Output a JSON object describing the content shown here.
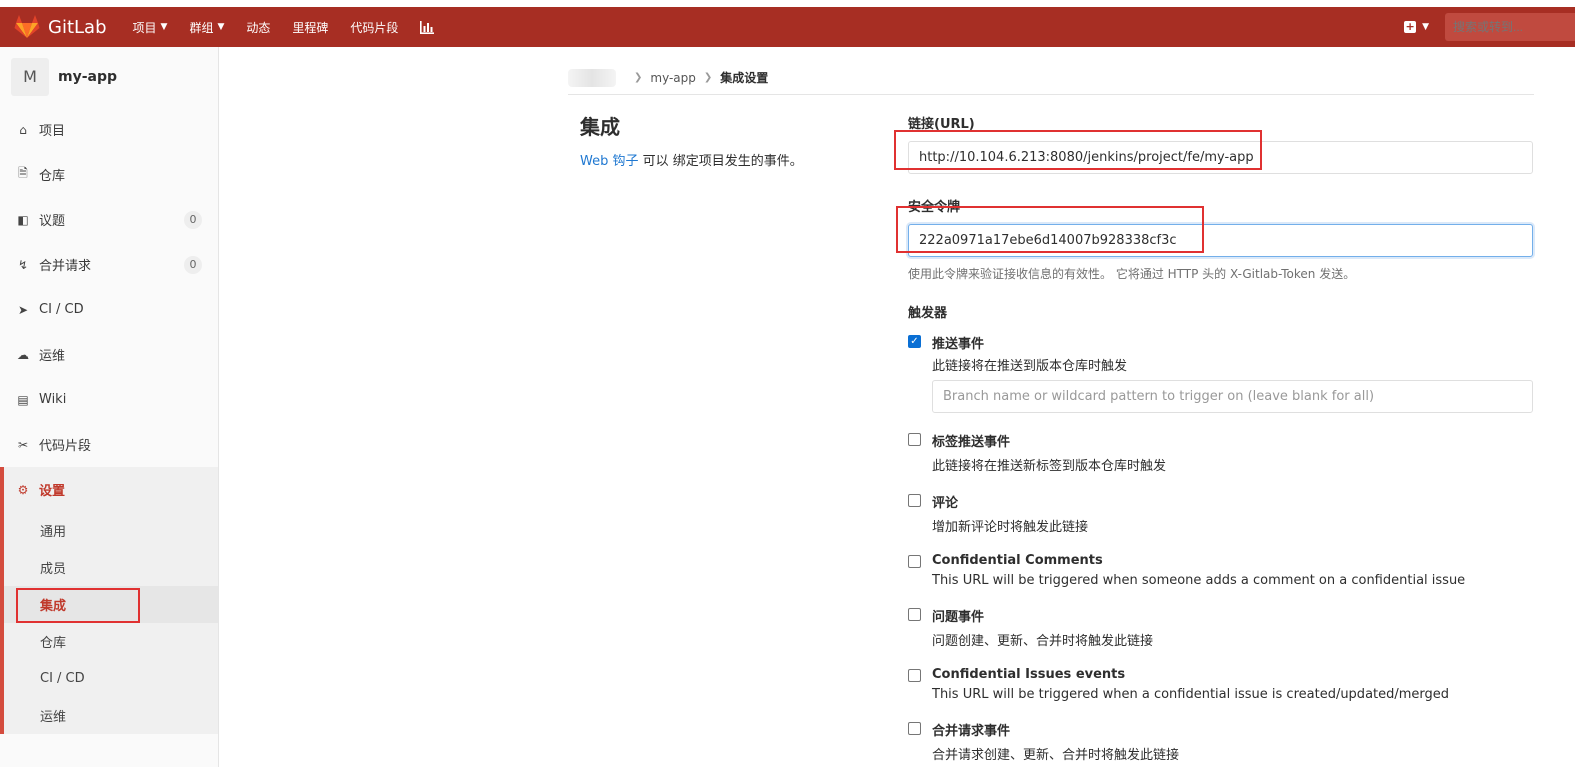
{
  "navbar": {
    "brand": "GitLab",
    "links": [
      {
        "label": "项目",
        "caret": true
      },
      {
        "label": "群组",
        "caret": true
      },
      {
        "label": "动态",
        "caret": false
      },
      {
        "label": "里程碑",
        "caret": false
      },
      {
        "label": "代码片段",
        "caret": false
      }
    ],
    "search_placeholder": "搜索或转到...",
    "color": "#a72e23"
  },
  "sidebar": {
    "avatar_letter": "M",
    "project_name": "my-app",
    "items": [
      {
        "label": "项目",
        "icon": "home-icon"
      },
      {
        "label": "仓库",
        "icon": "doc-icon"
      },
      {
        "label": "议题",
        "icon": "issues-icon",
        "count": "0"
      },
      {
        "label": "合并请求",
        "icon": "merge-request-icon",
        "count": "0"
      },
      {
        "label": "CI / CD",
        "icon": "rocket-icon"
      },
      {
        "label": "运维",
        "icon": "cloud-gear-icon"
      },
      {
        "label": "Wiki",
        "icon": "book-icon"
      },
      {
        "label": "代码片段",
        "icon": "scissors-icon"
      }
    ],
    "settings": {
      "label": "设置",
      "icon": "gear-icon",
      "sub_items": [
        "通用",
        "成员",
        "集成",
        "仓库",
        "CI / CD",
        "运维"
      ],
      "active_sub": "集成"
    }
  },
  "breadcrumb": {
    "project": "my-app",
    "current": "集成设置"
  },
  "intro": {
    "title": "集成",
    "link_text": "Web 钩子",
    "desc_text": " 可以 绑定项目发生的事件。"
  },
  "form": {
    "url_label": "链接(URL)",
    "url_value": "http://10.104.6.213:8080/jenkins/project/fe/my-app",
    "token_label": "安全令牌",
    "token_value": "222a0971a17ebe6d14007b928338cf3c",
    "token_help": "使用此令牌来验证接收信息的有效性。 它将通过 HTTP 头的 X-Gitlab-Token 发送。",
    "triggers_label": "触发器",
    "branch_placeholder": "Branch name or wildcard pattern to trigger on (leave blank for all)",
    "triggers": [
      {
        "title": "推送事件",
        "desc": "此链接将在推送到版本仓库时触发",
        "checked": true
      },
      {
        "title": "标签推送事件",
        "desc": "此链接将在推送新标签到版本仓库时触发",
        "checked": false
      },
      {
        "title": "评论",
        "desc": "增加新评论时将触发此链接",
        "checked": false
      },
      {
        "title": "Confidential Comments",
        "desc": "This URL will be triggered when someone adds a comment on a confidential issue",
        "checked": false
      },
      {
        "title": "问题事件",
        "desc": "问题创建、更新、合并时将触发此链接",
        "checked": false
      },
      {
        "title": "Confidential Issues events",
        "desc": "This URL will be triggered when a confidential issue is created/updated/merged",
        "checked": false
      },
      {
        "title": "合并请求事件",
        "desc": "合并请求创建、更新、合并时将触发此链接",
        "checked": false
      }
    ]
  }
}
